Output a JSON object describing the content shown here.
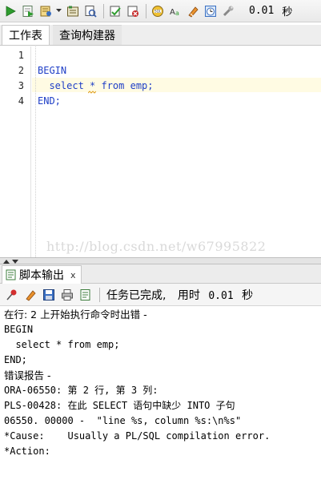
{
  "toolbar": {
    "elapsed_value": "0.01",
    "elapsed_unit": "秒"
  },
  "tabs": [
    {
      "label": "工作表"
    },
    {
      "label": "查询构建器"
    }
  ],
  "editor": {
    "line_numbers": [
      "1",
      "2",
      "3",
      "4"
    ],
    "lines": [
      "",
      "BEGIN",
      "  select * from emp;",
      "END;"
    ],
    "watermark": "http://blog.csdn.net/w67995822"
  },
  "output_panel": {
    "tab_label": "脚本输出",
    "close_label": "x",
    "status_text": "任务已完成,",
    "time_label": "用时",
    "time_value": "0.01",
    "time_unit": "秒",
    "lines": [
      "在行: 2 上开始执行命令时出错 -",
      "BEGIN",
      "  select * from emp;",
      "END;",
      "错误报告 -",
      "ORA-06550: 第 2 行, 第 3 列:",
      "PLS-00428: 在此 SELECT 语句中缺少 INTO 子句",
      "06550. 00000 -  \"line %s, column %s:\\n%s\"",
      "*Cause:    Usually a PL/SQL compilation error.",
      "*Action:"
    ]
  },
  "colors": {
    "keyword": "#1f3fc7",
    "current_line": "#fffbe3",
    "run_green": "#2e9c2e"
  },
  "icons": [
    "run-icon",
    "run-script-icon",
    "autotrace-icon",
    "dropdown-arrow-icon",
    "explain-plan-icon",
    "sql-tuning-icon",
    "commit-icon",
    "rollback-icon",
    "sql-history-icon",
    "format-icon",
    "clear-icon",
    "history-icon",
    "tools-icon",
    "pin-icon",
    "eraser-icon",
    "save-icon",
    "print-icon",
    "load-icon"
  ]
}
